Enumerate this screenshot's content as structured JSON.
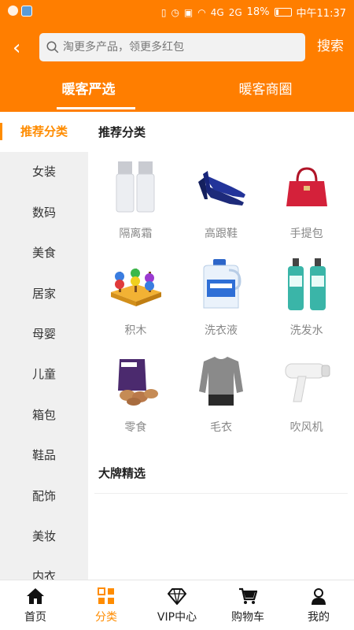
{
  "status_bar": {
    "battery": "18%",
    "time": "中午11:37",
    "signal_a": "4G",
    "signal_b": "2G"
  },
  "header": {
    "search_placeholder": "淘更多产品，领更多红包",
    "search_button": "搜索",
    "tabs": [
      {
        "label": "暖客严选"
      },
      {
        "label": "暖客商圈"
      }
    ]
  },
  "sidebar": {
    "items": [
      {
        "label": "推荐分类"
      },
      {
        "label": "女装"
      },
      {
        "label": "数码"
      },
      {
        "label": "美食"
      },
      {
        "label": "居家"
      },
      {
        "label": "母婴"
      },
      {
        "label": "儿童"
      },
      {
        "label": "箱包"
      },
      {
        "label": "鞋品"
      },
      {
        "label": "配饰"
      },
      {
        "label": "美妆"
      },
      {
        "label": "内衣"
      }
    ]
  },
  "main": {
    "section1_title": "推荐分类",
    "section2_title": "大牌精选",
    "categories": [
      {
        "label": "隔离霜"
      },
      {
        "label": "高跟鞋"
      },
      {
        "label": "手提包"
      },
      {
        "label": "积木"
      },
      {
        "label": "洗衣液"
      },
      {
        "label": "洗发水"
      },
      {
        "label": "零食"
      },
      {
        "label": "毛衣"
      },
      {
        "label": "吹风机"
      }
    ]
  },
  "bottom_nav": {
    "items": [
      {
        "label": "首页"
      },
      {
        "label": "分类"
      },
      {
        "label": "VIP中心"
      },
      {
        "label": "购物车"
      },
      {
        "label": "我的"
      }
    ]
  },
  "colors": {
    "brand": "#ff7e00",
    "active": "#ff8c00"
  }
}
